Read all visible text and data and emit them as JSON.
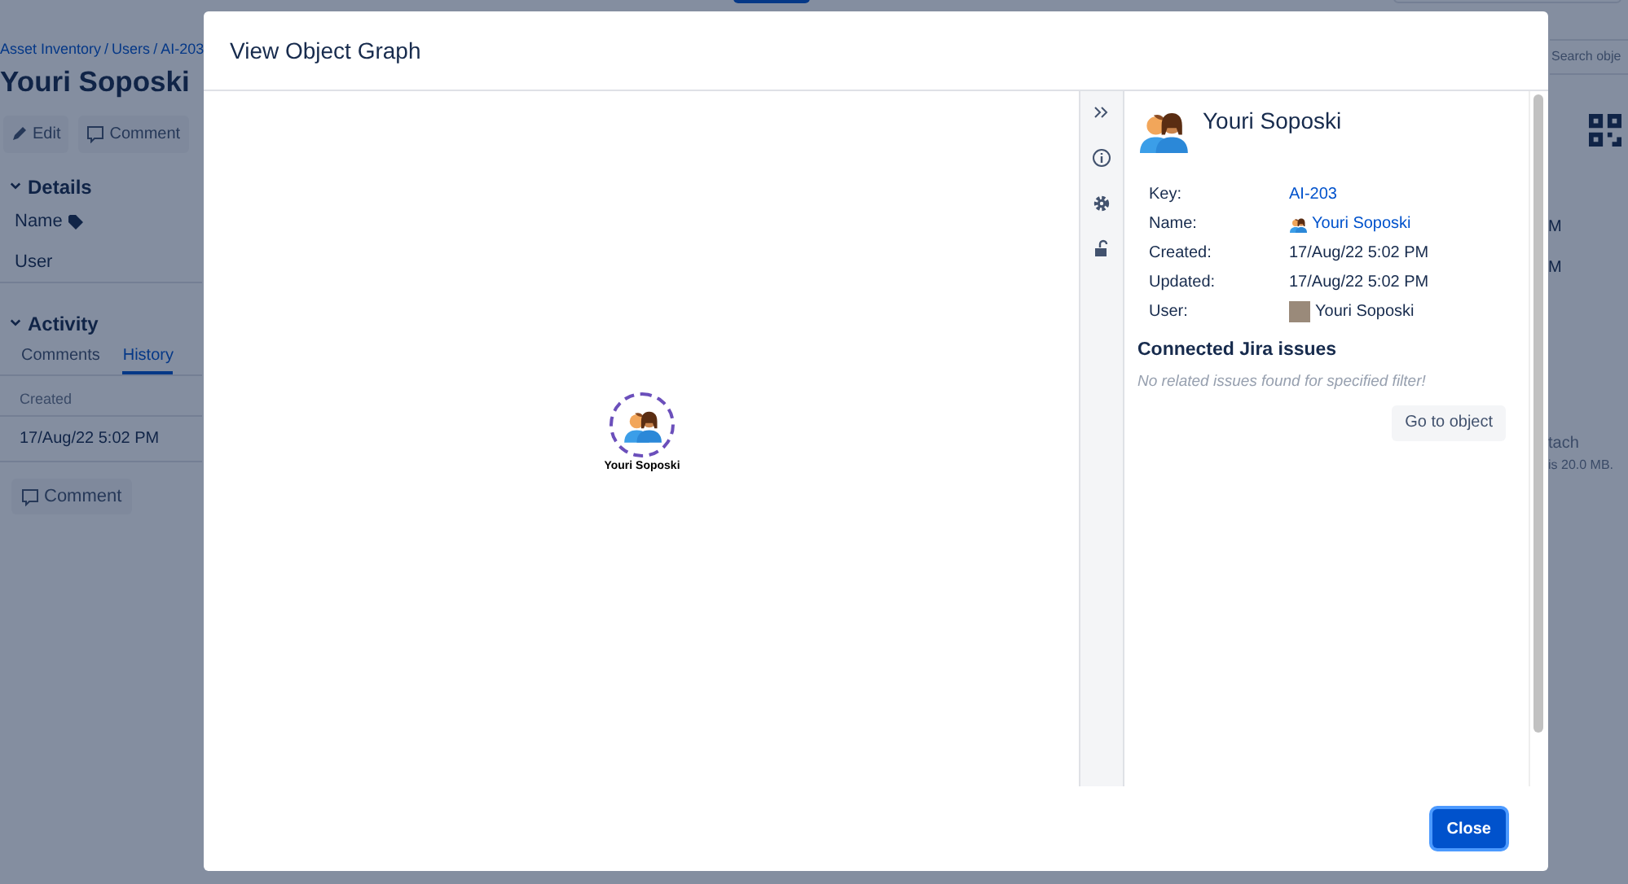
{
  "background_page": {
    "breadcrumbs": [
      "Asset Inventory",
      "Users",
      "AI-203"
    ],
    "breadcrumb_separator": "/",
    "title": "Youri Soposki",
    "actions": [
      {
        "kind": "edit",
        "label": "Edit"
      },
      {
        "kind": "comment",
        "label": "Comment"
      }
    ],
    "details": {
      "title": "Details",
      "fields": [
        {
          "label": "Name",
          "tagged": true
        },
        {
          "label": "User",
          "tagged": false
        }
      ]
    },
    "activity": {
      "title": "Activity",
      "tabs": [
        {
          "label": "Comments",
          "selected": false
        },
        {
          "label": "History",
          "selected": true
        }
      ],
      "column": "Created",
      "cell": "17/Aug/22 5:02 PM",
      "comment_button": "Comment"
    },
    "right_edge": {
      "search_placeholder": "Search obje",
      "values": [
        "M",
        "M"
      ],
      "attach": "tach",
      "attach_note": "is 20.0 MB."
    }
  },
  "modal": {
    "title": "View Object Graph",
    "graph": {
      "node_label": "Youri Soposki"
    },
    "details": {
      "name": "Youri Soposki",
      "attributes": [
        {
          "label": "Key:",
          "value": "AI-203",
          "kind": "link"
        },
        {
          "label": "Name:",
          "value": "Youri Soposki",
          "kind": "object"
        },
        {
          "label": "Created:",
          "value": "17/Aug/22 5:02 PM",
          "kind": "text"
        },
        {
          "label": "Updated:",
          "value": "17/Aug/22 5:02 PM",
          "kind": "text"
        },
        {
          "label": "User:",
          "value": "Youri Soposki",
          "kind": "user"
        }
      ],
      "connected_title": "Connected Jira issues",
      "empty_message": "No related issues found for specified filter!",
      "go_button": "Go to object"
    },
    "close_button": "Close"
  }
}
